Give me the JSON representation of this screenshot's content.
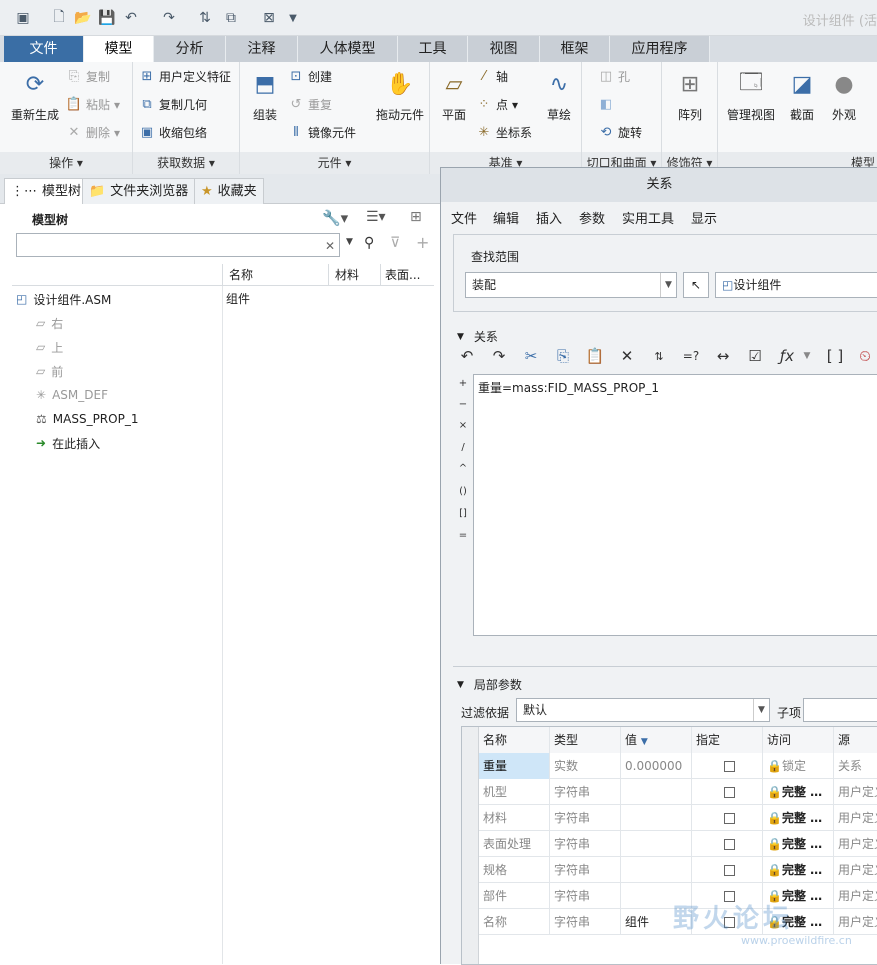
{
  "app": {
    "title": "设计组件 (活"
  },
  "tabs": [
    "文件",
    "模型",
    "分析",
    "注释",
    "人体模型",
    "工具",
    "视图",
    "框架",
    "应用程序"
  ],
  "ribbon": {
    "ops": {
      "label": "操作",
      "regen": "重新生成",
      "copy": "复制",
      "paste": "粘贴",
      "delete": "删除"
    },
    "getdata": {
      "label": "获取数据",
      "udf": "用户定义特征",
      "copygeom": "复制几何",
      "shrinkwrap": "收缩包络"
    },
    "comp": {
      "label": "元件",
      "assemble": "组装",
      "create": "创建",
      "repeat": "重复",
      "mirror": "镜像元件",
      "drag": "拖动元件"
    },
    "datum": {
      "label": "基准",
      "plane": "平面",
      "axis": "轴",
      "point": "点",
      "csys": "坐标系",
      "sketch": "草绘"
    },
    "cut": {
      "label": "切口和曲面",
      "hole": "孔",
      "revolve": "旋转"
    },
    "mod": {
      "label": "修饰符",
      "pattern": "阵列"
    },
    "view": {
      "label": "模型",
      "manage": "管理视图",
      "section": "截面",
      "appearance": "外观"
    }
  },
  "left": {
    "tabs": [
      "模型树",
      "文件夹浏览器",
      "收藏夹"
    ],
    "tree_label": "模型树",
    "cols": [
      "名称",
      "材料",
      "表面..."
    ],
    "items": [
      {
        "name": "设计组件.ASM",
        "type": "组件"
      },
      {
        "name": "右"
      },
      {
        "name": "上"
      },
      {
        "name": "前"
      },
      {
        "name": "ASM_DEF"
      },
      {
        "name": "MASS_PROP_1"
      },
      {
        "name": "在此插入"
      }
    ]
  },
  "dialog": {
    "title": "关系",
    "menus": [
      "文件",
      "编辑",
      "插入",
      "参数",
      "实用工具",
      "显示"
    ],
    "scope_label": "查找范围",
    "scope_value": "装配",
    "scope_target": "设计组件",
    "relations_label": "关系",
    "relation_text": "重量=mass:FID_MASS_PROP_1",
    "ops": [
      "+",
      "−",
      "×",
      "/",
      "^",
      "()",
      "[]",
      "="
    ],
    "local_label": "局部参数",
    "filter_label": "过滤依据",
    "filter_value": "默认",
    "sub_label": "子项",
    "columns": [
      "名称",
      "类型",
      "值",
      "指定",
      "访问",
      "源"
    ],
    "rows": [
      {
        "name": "重量",
        "type": "实数",
        "value": "0.000000",
        "access": "锁定",
        "source": "关系"
      },
      {
        "name": "机型",
        "type": "字符串",
        "value": "",
        "access": "完整",
        "source": "用户定义"
      },
      {
        "name": "材料",
        "type": "字符串",
        "value": "",
        "access": "完整",
        "source": "用户定义"
      },
      {
        "name": "表面处理",
        "type": "字符串",
        "value": "",
        "access": "完整",
        "source": "用户定义"
      },
      {
        "name": "规格",
        "type": "字符串",
        "value": "",
        "access": "完整",
        "source": "用户定义"
      },
      {
        "name": "部件",
        "type": "字符串",
        "value": "",
        "access": "完整",
        "source": "用户定义"
      },
      {
        "name": "名称",
        "type": "字符串",
        "value": "组件",
        "access": "完整",
        "source": "用户定义"
      }
    ]
  },
  "watermark": "野火论坛",
  "watermark_url": "www.proewildfire.cn"
}
